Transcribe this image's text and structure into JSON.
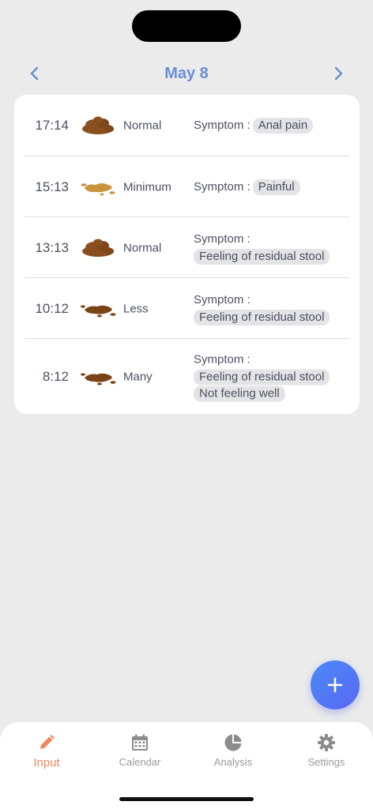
{
  "header": {
    "date": "May 8",
    "prev_icon": "chevron-left-icon",
    "next_icon": "chevron-right-icon"
  },
  "entries": [
    {
      "time": "17:14",
      "amount": "Normal",
      "stool_icon": "stool-normal-icon",
      "stool_color": "#8a4f1e",
      "symptom_label": "Symptom :",
      "symptoms": [
        "Anal pain"
      ]
    },
    {
      "time": "15:13",
      "amount": "Minimum",
      "stool_icon": "stool-minimum-icon",
      "stool_color": "#c8943c",
      "symptom_label": "Symptom :",
      "symptoms": [
        "Painful"
      ]
    },
    {
      "time": "13:13",
      "amount": "Normal",
      "stool_icon": "stool-normal-icon",
      "stool_color": "#8a4f1e",
      "symptom_label": "Symptom :",
      "symptoms": [
        "Feeling of residual stool"
      ]
    },
    {
      "time": "10:12",
      "amount": "Less",
      "stool_icon": "stool-less-icon",
      "stool_color": "#7a4516",
      "symptom_label": "Symptom :",
      "symptoms": [
        "Feeling of residual stool"
      ]
    },
    {
      "time": "8:12",
      "amount": "Many",
      "stool_icon": "stool-many-icon",
      "stool_color": "#7a4516",
      "symptom_label": "Symptom :",
      "symptoms": [
        "Feeling of residual stool",
        "Not feeling well"
      ]
    }
  ],
  "fab": {
    "icon": "plus-icon"
  },
  "tabs": [
    {
      "label": "Input",
      "icon": "pencil-icon",
      "active": true
    },
    {
      "label": "Calendar",
      "icon": "calendar-icon",
      "active": false
    },
    {
      "label": "Analysis",
      "icon": "pie-chart-icon",
      "active": false
    },
    {
      "label": "Settings",
      "icon": "gear-icon",
      "active": false
    }
  ],
  "colors": {
    "accent": "#6a8fd8",
    "active_tab": "#f0875f",
    "fab_gradient_start": "#4a8af7",
    "fab_gradient_end": "#5868f3",
    "background": "#ebebeb"
  }
}
